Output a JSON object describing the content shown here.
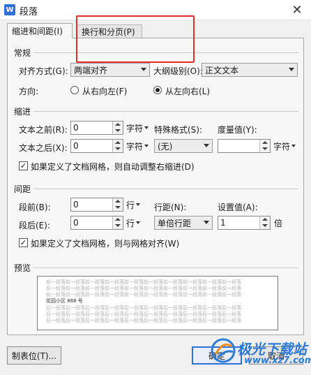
{
  "window": {
    "title": "段落",
    "app_icon_label": "W"
  },
  "tabs": [
    {
      "label": "缩进和间距(I)",
      "active": true
    },
    {
      "label": "换行和分页(P)",
      "active": false
    }
  ],
  "general": {
    "section_title": "常规",
    "alignment_label": "对齐方式(G):",
    "alignment_value": "两端对齐",
    "outline_label": "大纲级别(O):",
    "outline_value": "正文文本",
    "direction_label": "方向:",
    "rtl_label": "从右向左(F)",
    "ltr_label": "从左向右(L)",
    "direction_selected": "从左向右(L)"
  },
  "indent": {
    "section_title": "缩进",
    "before_label": "文本之前(R):",
    "before_value": "0",
    "before_unit": "字符",
    "after_label": "文本之后(X):",
    "after_value": "0",
    "after_unit": "字符",
    "special_label": "特殊格式(S):",
    "special_value": "(无)",
    "measure_label": "度量值(Y):",
    "measure_value": "",
    "measure_unit": "字符",
    "auto_adjust_label": "如果定义了文档网格，则自动调整右缩进(D)",
    "auto_adjust_checked": true
  },
  "spacing": {
    "section_title": "间距",
    "before_label": "段前(B):",
    "before_value": "0",
    "before_unit": "行",
    "after_label": "段后(E):",
    "after_value": "0",
    "after_unit": "行",
    "line_label": "行距(N):",
    "line_value": "单倍行距",
    "setting_label": "设置值(A):",
    "setting_value": "1",
    "setting_unit": "倍",
    "grid_align_label": "如果定义了文档网格，则与网格对齐(W)",
    "grid_align_checked": true
  },
  "preview": {
    "section_title": "预览",
    "lines": [
      "前一段落前一段落前一段落前一段落前一段落前一段落前一段落前一段落前一段落前一段落",
      "前一段落前一段落前一段落前一段落前一段落前一段落前一段落前一段落前一段落前一段落",
      "前一段落前一段落前一段落前一段落前一段落前一段落前一段落前一段落前一段落前一段落",
      "花园小区 888 号",
      "后一段落后一段落后一段落后一段落后一段落后一段落后一段落后一段落后一段落后一段落",
      "后一段落后一段落后一段落后一段落后一段落后一段落后一段落后一段落后一段落后一段落",
      "后一段落后一段落后一段落后一段落后一段落后一段落后一段落后一段落后一段落后一段落"
    ]
  },
  "footer": {
    "tab_stops_label": "制表位(T)...",
    "ok_label": "确定",
    "cancel_label": "取消"
  },
  "watermark": {
    "brand": "极光下载站",
    "url": "www.xz7.com"
  },
  "colors": {
    "accent": "#2f6fd6",
    "highlight": "#e52b2b",
    "watermark": "#2d7bd6"
  }
}
